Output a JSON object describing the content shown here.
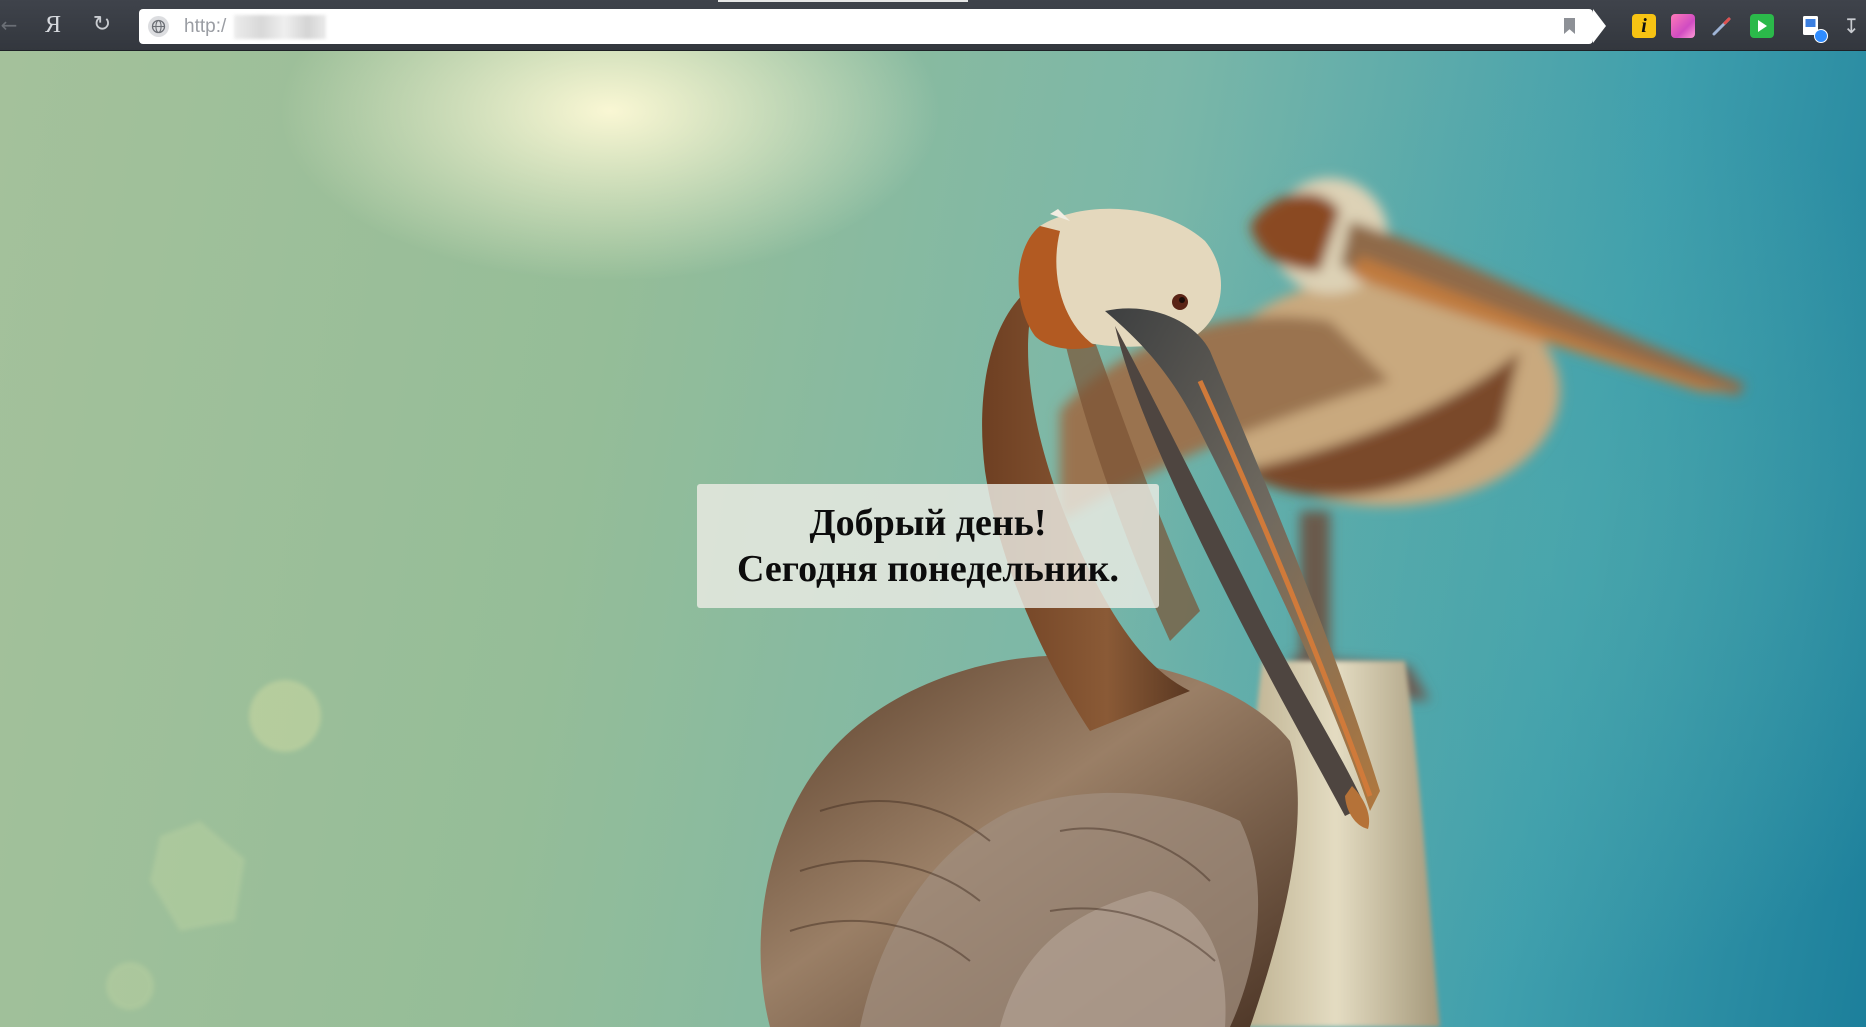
{
  "browser": {
    "address_bar": {
      "url": "http:/"
    },
    "extensions": [
      "i-extension-icon",
      "pink-extension-icon",
      "pen-extension-icon",
      "green-play-extension-icon",
      "screenshot-extension-icon"
    ],
    "colors": {
      "toolbar": "#383c43",
      "omnibox": "#ffffff"
    }
  },
  "page": {
    "greeting": {
      "line1": "Добрый день!",
      "line2": "Сегодня понедельник."
    }
  }
}
